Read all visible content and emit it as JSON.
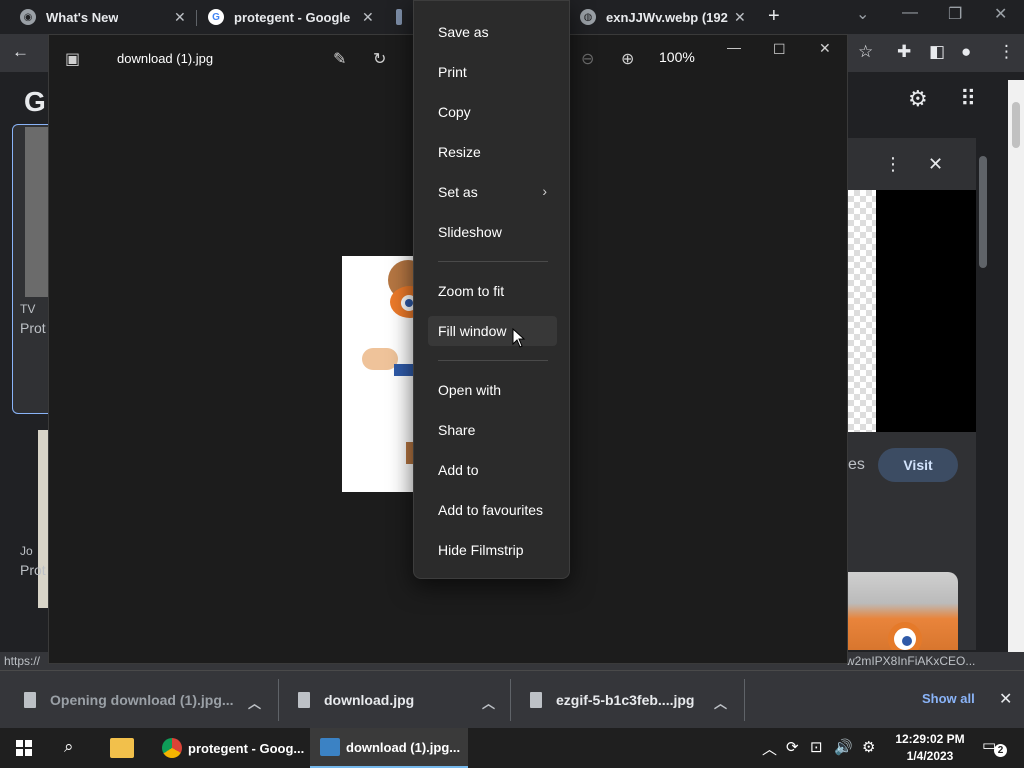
{
  "browser": {
    "tabs": [
      {
        "title": "What's New",
        "icon": "chrome-icon"
      },
      {
        "title": "protegent - Google S",
        "icon": "google-icon"
      },
      {
        "title": "",
        "icon": "image-icon"
      },
      {
        "title": "exnJJWv.webp (192",
        "icon": "globe-icon"
      }
    ],
    "new_tab": "+",
    "status_url_left": "https://",
    "status_url_right": "w2mIPX8InFiAKxCEO...",
    "page": {
      "logo": "G",
      "left_card_badge": "TV",
      "left_card_title": "Prot",
      "left_card2_badge": "Jo",
      "left_card2_title": "Prot",
      "right_panel_suffix": "es",
      "visit_label": "Visit"
    }
  },
  "photos_app": {
    "file_name": "download (1).jpg",
    "zoom": "100%"
  },
  "context_menu": {
    "items": [
      {
        "label": "Save as"
      },
      {
        "label": "Print"
      },
      {
        "label": "Copy"
      },
      {
        "label": "Resize"
      },
      {
        "label": "Set as",
        "submenu": "›"
      },
      {
        "label": "Slideshow"
      },
      {
        "label": "Zoom to fit"
      },
      {
        "label": "Fill window",
        "hovered": true
      },
      {
        "label": "Open with"
      },
      {
        "label": "Share"
      },
      {
        "label": "Add to"
      },
      {
        "label": "Add to favourites"
      },
      {
        "label": "Hide Filmstrip"
      }
    ]
  },
  "downloads": {
    "items": [
      {
        "label": "Opening download (1).jpg..."
      },
      {
        "label": "download.jpg"
      },
      {
        "label": "ezgif-5-b1c3feb....jpg"
      }
    ],
    "show_all": "Show all"
  },
  "taskbar": {
    "apps": [
      {
        "label": "protegent - Goog..."
      },
      {
        "label": "download (1).jpg..."
      }
    ],
    "time": "12:29:02 PM",
    "date": "1/4/2023",
    "notifications": "2"
  },
  "colors": {
    "accent": "#8ab4f8",
    "menu_bg": "#2b2b2b",
    "taskbar_active": "#76b9ed"
  }
}
